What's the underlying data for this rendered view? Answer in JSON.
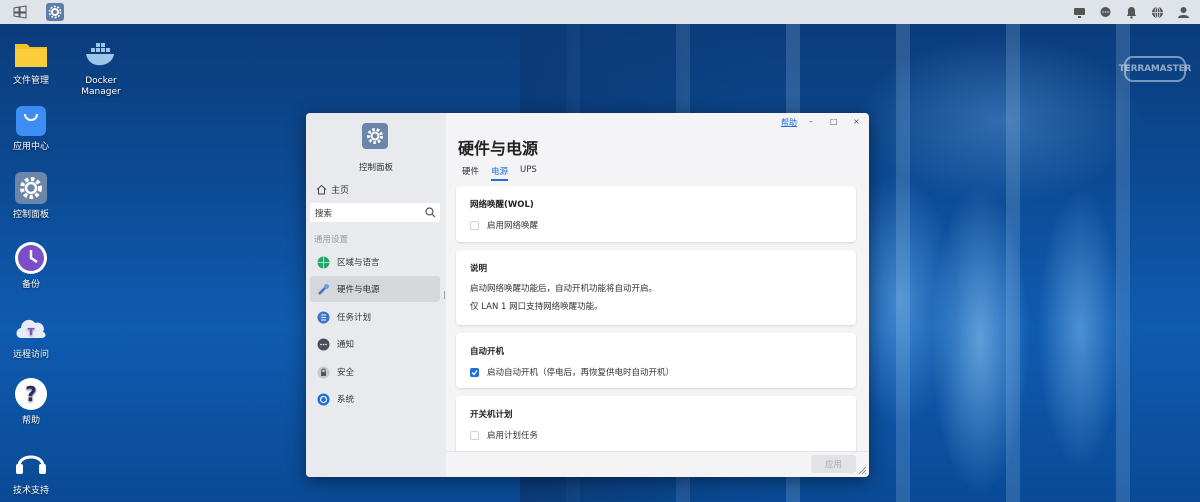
{
  "desktop": {
    "icons": [
      {
        "label": "文件管理"
      },
      {
        "label": "Docker Manager"
      },
      {
        "label": "应用中心"
      },
      {
        "label": "控制面板"
      },
      {
        "label": "备份"
      },
      {
        "label": "远程访问"
      },
      {
        "label": "帮助"
      },
      {
        "label": "技术支持"
      }
    ],
    "brand": "TERRAMASTER"
  },
  "window": {
    "help": "帮助",
    "controls": [
      "–",
      "□",
      "×"
    ],
    "sidebar": {
      "title": "控制面板",
      "home": "主页",
      "search_placeholder": "搜索",
      "section": "通用设置",
      "items": [
        {
          "label": "区域与语言",
          "icon": "globe-icon"
        },
        {
          "label": "硬件与电源",
          "icon": "hardware-icon",
          "active": true
        },
        {
          "label": "任务计划",
          "icon": "list-icon"
        },
        {
          "label": "通知",
          "icon": "chat-icon"
        },
        {
          "label": "安全",
          "icon": "lock-icon"
        },
        {
          "label": "系统",
          "icon": "system-icon"
        }
      ]
    },
    "title": "硬件与电源",
    "tabs": [
      {
        "label": "硬件"
      },
      {
        "label": "电源",
        "active": true
      },
      {
        "label": "UPS"
      }
    ],
    "cards": {
      "wol": {
        "title": "网络唤醒(WOL)",
        "option": "启用网络唤醒",
        "checked": false
      },
      "note": {
        "title": "说明",
        "lines": [
          "启动网络唤醒功能后，自动开机功能将自动开启。",
          "仅 LAN 1 网口支持网络唤醒功能。"
        ]
      },
      "autostart": {
        "title": "自动开机",
        "option": "启动自动开机（停电后，再恢复供电时自动开机）",
        "checked": true
      },
      "schedule": {
        "title": "开关机计划",
        "option": "启用计划任务",
        "checked": false
      }
    },
    "apply": "应用"
  },
  "colors": {
    "accent": "#1e6fd9",
    "taskbar": "#dfe3ea"
  }
}
